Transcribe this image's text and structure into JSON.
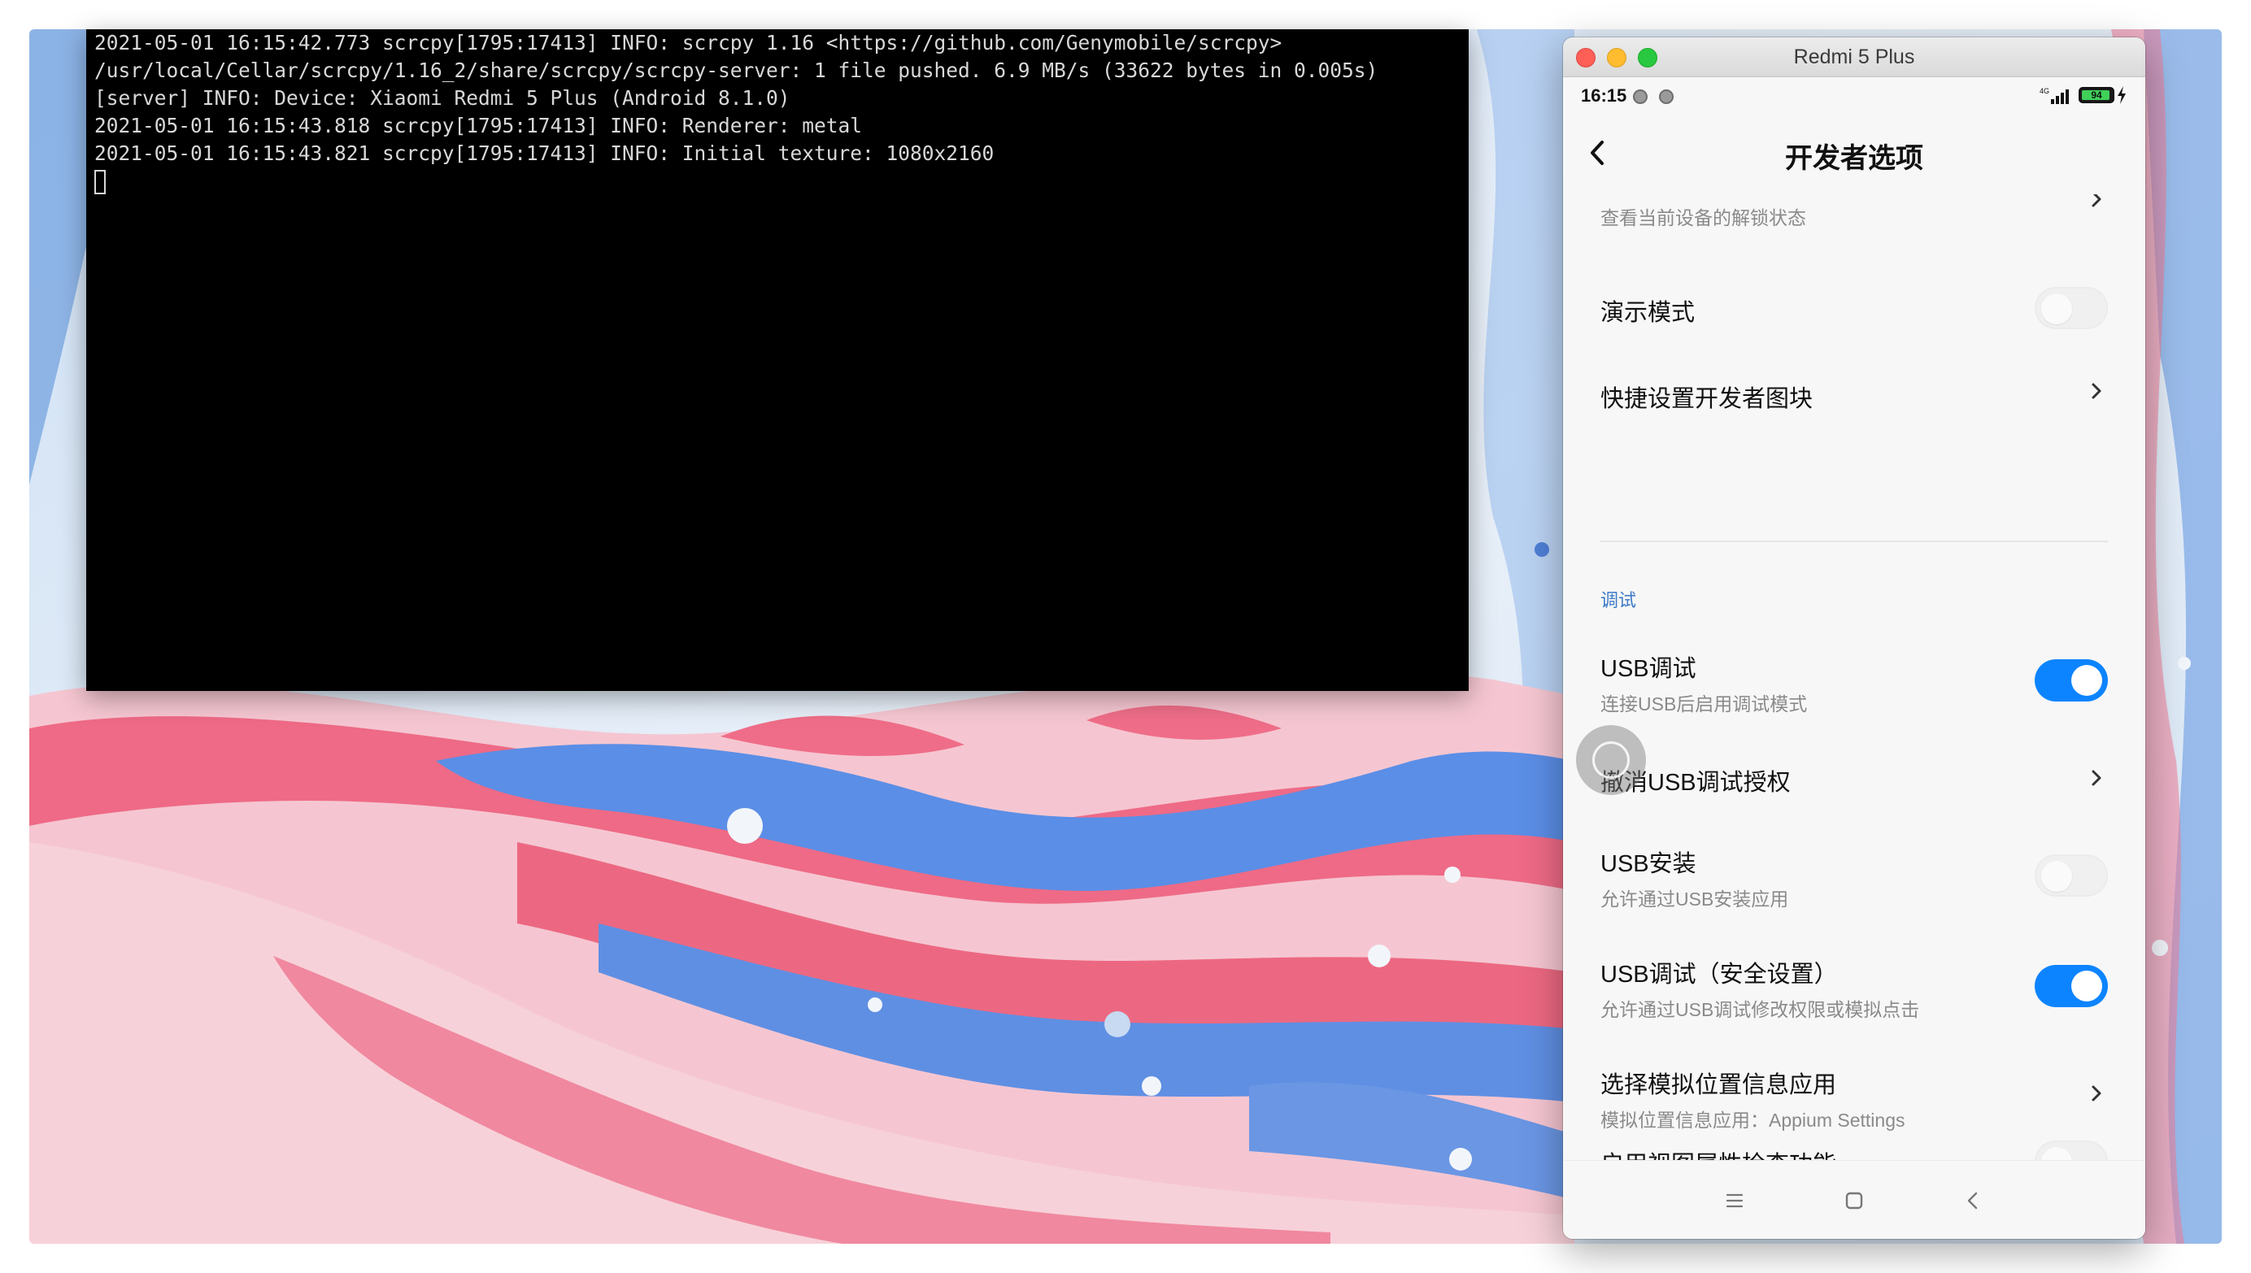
{
  "terminal": {
    "lines": [
      "2021-05-01 16:15:42.773 scrcpy[1795:17413] INFO: scrcpy 1.16 <https://github.com/Genymobile/scrcpy>",
      "/usr/local/Cellar/scrcpy/1.16_2/share/scrcpy/scrcpy-server: 1 file pushed. 6.9 MB/s (33622 bytes in 0.005s)",
      "[server] INFO: Device: Xiaomi Redmi 5 Plus (Android 8.1.0)",
      "2021-05-01 16:15:43.818 scrcpy[1795:17413] INFO: Renderer: metal",
      "2021-05-01 16:15:43.821 scrcpy[1795:17413] INFO: Initial texture: 1080x2160"
    ]
  },
  "window": {
    "title": "Redmi 5 Plus"
  },
  "phone": {
    "status_bar": {
      "time": "16:15",
      "network": "4G",
      "battery": "94",
      "battery_level": 0.94
    },
    "page_title": "开发者选项",
    "settings": {
      "unlock_status_sub": "查看当前设备的解锁状态",
      "demo_mode": "演示模式",
      "quick_tiles": "快捷设置开发者图块",
      "section_debug": "调试",
      "usb_debugging": {
        "title": "USB调试",
        "sub": "连接USB后启用调试模式",
        "enabled": true
      },
      "revoke_usb_auth": "撤消USB调试授权",
      "usb_install": {
        "title": "USB安装",
        "sub": "允许通过USB安装应用",
        "enabled": false
      },
      "usb_debug_security": {
        "title": "USB调试（安全设置）",
        "sub": "允许通过USB调试修改权限或模拟点击",
        "enabled": true
      },
      "mock_location": {
        "title": "选择模拟位置信息应用",
        "sub": "模拟位置信息应用：Appium Settings"
      },
      "view_attr_inspection": {
        "title": "启用视图属性检查功能",
        "enabled": false
      }
    }
  },
  "colors": {
    "toggle_on": "#0d84ff",
    "section_label": "#3d7bc7",
    "terminal_bg": "#000000"
  }
}
